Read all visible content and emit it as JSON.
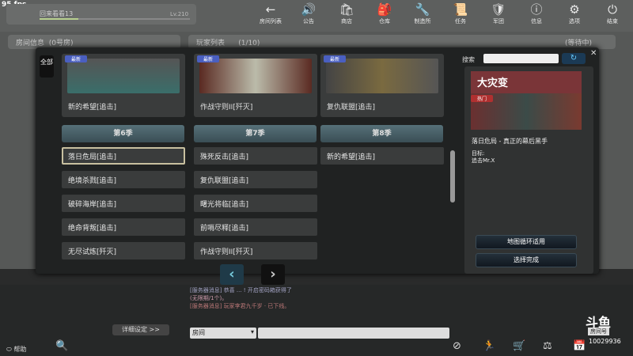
{
  "fps": "95 fps",
  "user": {
    "name": "回来看看13",
    "level": "Lv.210",
    "xp_fraction": 0.26
  },
  "nav": [
    {
      "icon": "←",
      "label": "房间列表"
    },
    {
      "icon": "🔊",
      "label": "公告"
    },
    {
      "icon": "🛍",
      "label": "商店"
    },
    {
      "icon": "🎒",
      "label": "仓库"
    },
    {
      "icon": "🔧",
      "label": "制造所"
    },
    {
      "icon": "📜",
      "label": "任务"
    },
    {
      "icon": "🛡",
      "label": "军团"
    },
    {
      "icon": "ⓘ",
      "label": "信息"
    },
    {
      "icon": "⚙",
      "label": "选项"
    },
    {
      "icon": "⏻",
      "label": "结束"
    }
  ],
  "room_info": {
    "title": "房间信息",
    "sub": "(0号房)"
  },
  "player_list": {
    "title": "玩家列表",
    "count": "(1/10)",
    "status": "(等待中)"
  },
  "modal": {
    "all_tab": "全部",
    "cards": [
      {
        "badge": "最新",
        "title": "新的希望[追击]"
      },
      {
        "badge": "最新",
        "title": "作战守则II[歼灭]"
      },
      {
        "badge": "最新",
        "title": "复仇联盟[追击]"
      }
    ],
    "seasons": [
      "第6季",
      "第7季",
      "第8季"
    ],
    "columns": [
      [
        "落日危局[追击]",
        "绝境杀戮[追击]",
        "破碎海岸[追击]",
        "绝命背叛[追击]",
        "无尽试炼[歼灭]"
      ],
      [
        "殊死反击[追击]",
        "复仇联盟[追击]",
        "曙光将临[追击]",
        "前哨尽释[追击]",
        "作战守则II[歼灭]"
      ],
      [
        "新的希望[追击]"
      ]
    ],
    "selected": "落日危局[追击]",
    "search_label": "搜索",
    "search_value": "",
    "detail": {
      "banner": "大灾变",
      "hot": "热门",
      "desc": "落日危局 - 真正的幕后黑手",
      "goal_label": "目标:",
      "goal": "追击Mr.X"
    },
    "loop_button": "地图循环适用",
    "done_button": "选择完成"
  },
  "chat": [
    "[服务器消息] 恭喜 ... ! 开启密码箱获得了",
    "(无限期/1个)。",
    "[服务器消息] 玩家李君九千岁 · 已下线。"
  ],
  "detail_settings": "详细设定 >>",
  "chat_channel": "房间",
  "help": "帮助",
  "room_tag": "房间号",
  "room_number": "10029936",
  "logo": "斗鱼"
}
